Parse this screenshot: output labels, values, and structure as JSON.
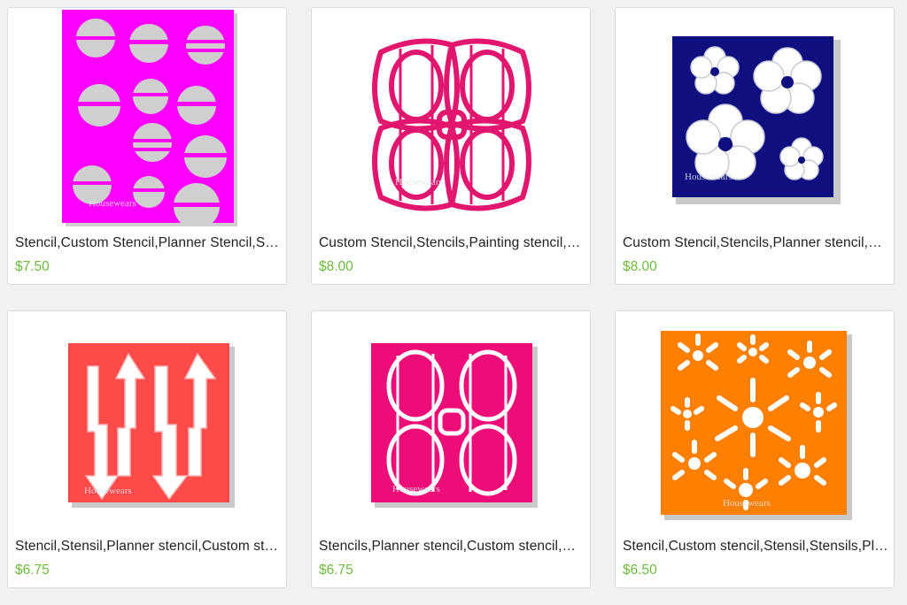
{
  "products": [
    {
      "title": "Stencil,Custom Stencil,Planner Stencil,Stencils,Sten...",
      "price": "$7.50",
      "color": "#ff00ff",
      "image": "circles-stencil"
    },
    {
      "title": "Custom Stencil,Stencils,Painting stencil,Planner stencil",
      "price": "$8.00",
      "color": "#e2166e",
      "image": "lattice-stencil"
    },
    {
      "title": "Custom Stencil,Stencils,Planner stencil,Stencil",
      "price": "$8.00",
      "color": "#0f0f80",
      "image": "flower-stencil"
    },
    {
      "title": "Stencil,Stensil,Planner stencil,Custom stencil",
      "price": "$6.75",
      "color": "#ff4a4a",
      "image": "arrow-stencil"
    },
    {
      "title": "Stencils,Planner stencil,Custom stencil,Stencil",
      "price": "$6.75",
      "color": "#ee0d78",
      "image": "lattice-square-stencil"
    },
    {
      "title": "Stencil,Custom stencil,Stensil,Stensils,Planner",
      "price": "$6.50",
      "color": "#ff7f00",
      "image": "sunburst-stencil"
    }
  ],
  "watermark": "Housewears"
}
